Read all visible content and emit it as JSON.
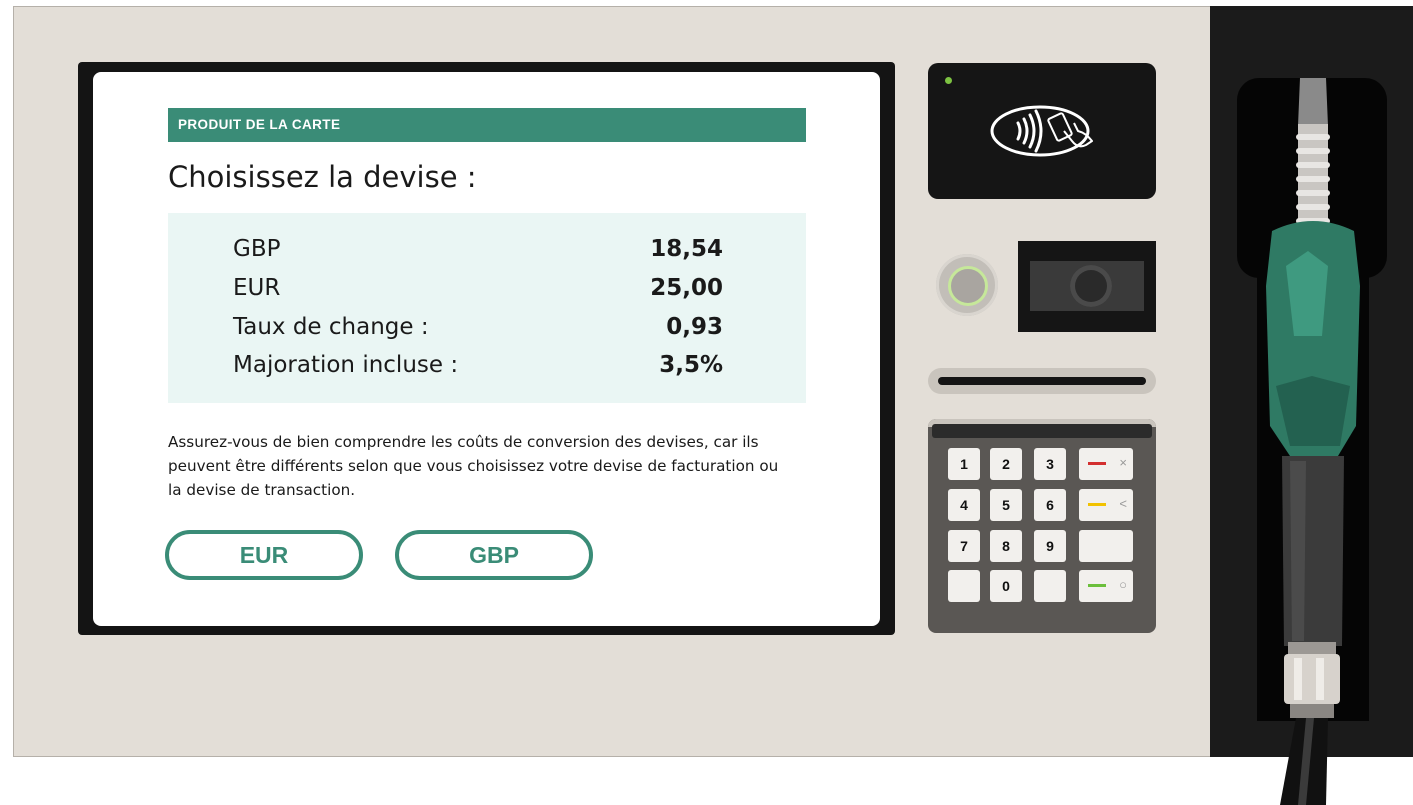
{
  "screen": {
    "header": "PRODUIT DE LA CARTE",
    "title": "Choisissez la devise :",
    "rows": [
      {
        "label": "GBP",
        "value": "18,54"
      },
      {
        "label": "EUR",
        "value": "25,00"
      },
      {
        "label": "Taux de change :",
        "value": "0,93"
      },
      {
        "label": "Majoration incluse :",
        "value": "3,5%"
      }
    ],
    "notice": "Assurez-vous de bien comprendre les coûts de conversion des devises, car ils peuvent être différents selon que vous choisissez votre devise de facturation ou la devise de transaction.",
    "buttons": {
      "eur": "EUR",
      "gbp": "GBP"
    }
  },
  "pinpad": {
    "keys": [
      "1",
      "2",
      "3",
      "4",
      "5",
      "6",
      "7",
      "8",
      "9",
      "0"
    ],
    "cancel_symbol": "×",
    "correct_symbol": "<",
    "confirm_symbol": "○"
  },
  "icons": {
    "contactless": "contactless-icon",
    "status_led": "status-led-icon"
  },
  "colors": {
    "accent": "#3a8c77",
    "info_background": "#eaf6f4",
    "cancel": "#d32f2f",
    "correct": "#f2c200",
    "confirm": "#6cbf3c",
    "led": "#7dc242"
  }
}
